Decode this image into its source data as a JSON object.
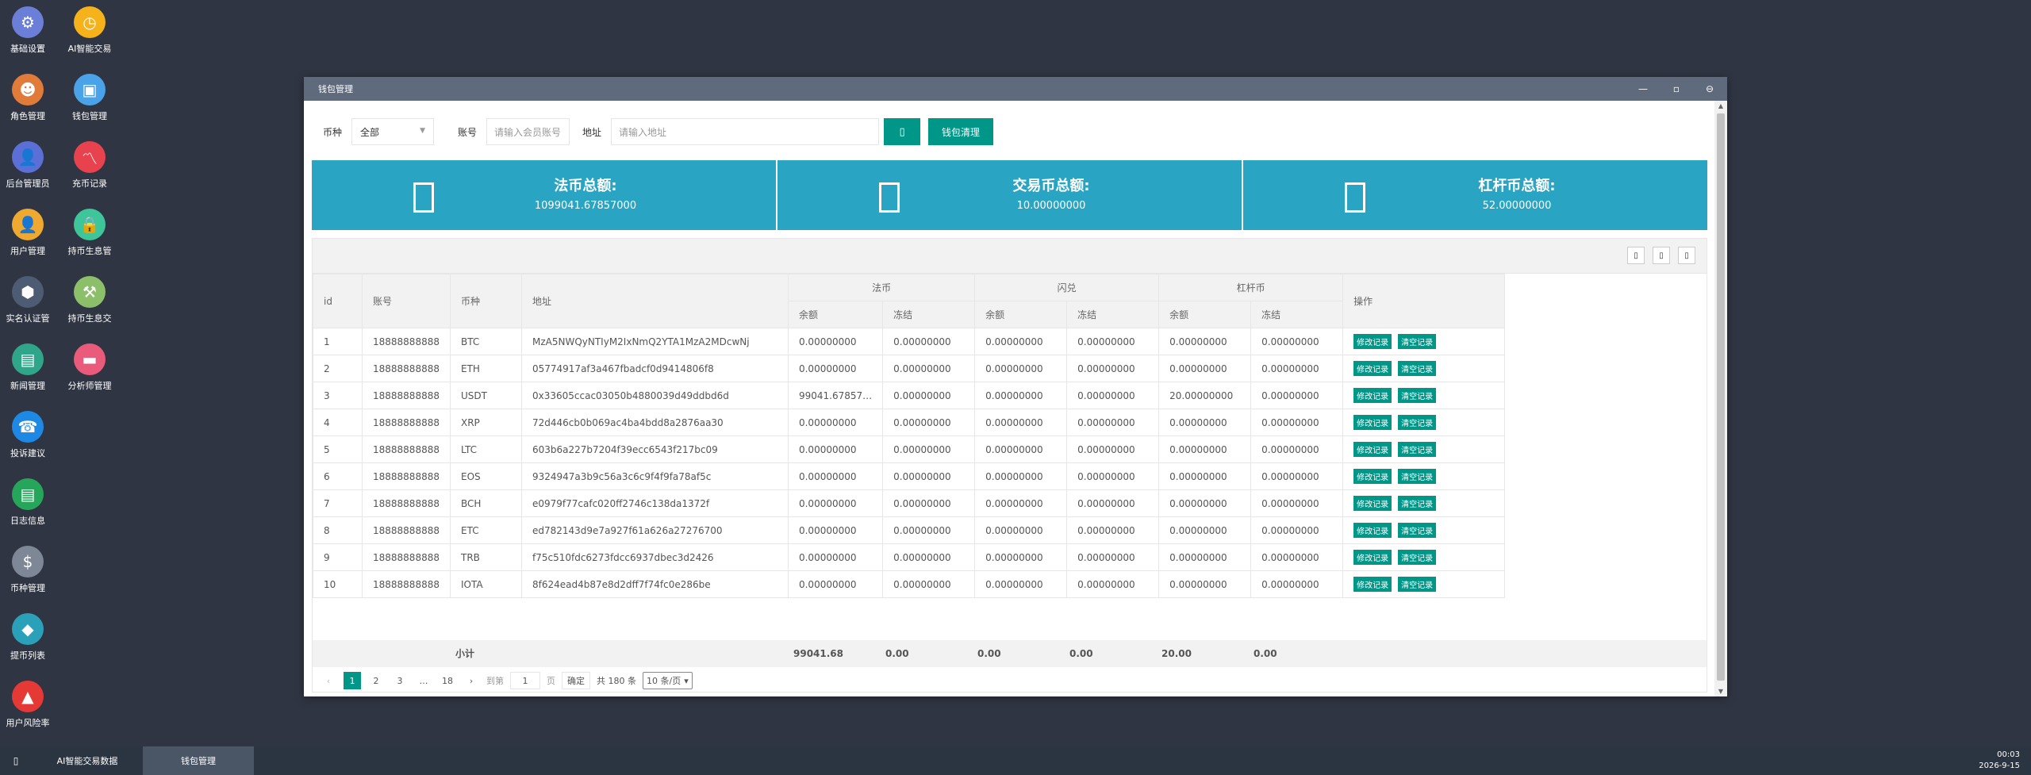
{
  "desktop": {
    "col1": [
      {
        "label": "基础设置",
        "icon": "gear-icon",
        "color": "#6c7fd8",
        "glyph": "⚙"
      },
      {
        "label": "角色管理",
        "icon": "roles-icon",
        "color": "#e07b39",
        "glyph": "☻"
      },
      {
        "label": "后台管理员",
        "icon": "admin-icon",
        "color": "#5b6fd6",
        "glyph": "👤"
      },
      {
        "label": "用户管理",
        "icon": "user-search-icon",
        "color": "#f0a930",
        "glyph": "👤"
      },
      {
        "label": "实名认证管",
        "icon": "verify-icon",
        "color": "#4d5b73",
        "glyph": "⬢"
      },
      {
        "label": "新闻管理",
        "icon": "news-icon",
        "color": "#2fa58a",
        "glyph": "▤"
      },
      {
        "label": "投诉建议",
        "icon": "feedback-icon",
        "color": "#1e88e5",
        "glyph": "☎"
      },
      {
        "label": "日志信息",
        "icon": "log-icon",
        "color": "#26a65b",
        "glyph": "▤"
      },
      {
        "label": "币种管理",
        "icon": "dollar-icon",
        "color": "#7d8796",
        "glyph": "$"
      },
      {
        "label": "提币列表",
        "icon": "withdraw-icon",
        "color": "#2aa1b8",
        "glyph": "◆"
      },
      {
        "label": "用户风险率",
        "icon": "alarm-icon",
        "color": "#e53935",
        "glyph": "▲"
      }
    ],
    "col2": [
      {
        "label": "AI智能交易",
        "icon": "stopwatch-icon",
        "color": "#f5b21a",
        "glyph": "◷"
      },
      {
        "label": "钱包管理",
        "icon": "wallet-icon",
        "color": "#4aa3e8",
        "glyph": "▣"
      },
      {
        "label": "充币记录",
        "icon": "chart-icon",
        "color": "#e8424f",
        "glyph": "〽"
      },
      {
        "label": "持币生息管",
        "icon": "lock-icon",
        "color": "#3ec59a",
        "glyph": "🔒"
      },
      {
        "label": "持币生息交",
        "icon": "hammer-icon",
        "color": "#8bbf6a",
        "glyph": "⚒"
      },
      {
        "label": "分析师管理",
        "icon": "store-icon",
        "color": "#ea5a7a",
        "glyph": "▬"
      }
    ]
  },
  "window": {
    "title": "钱包管理",
    "ctrls": [
      "—",
      "▫",
      "⊖"
    ]
  },
  "filter": {
    "currency_label": "币种",
    "currency_value": "全部",
    "account_label": "账号",
    "account_placeholder": "请输入会员账号",
    "address_label": "地址",
    "address_placeholder": "请输入地址",
    "search_glyph": "▯",
    "clear_label": "钱包清理"
  },
  "stats": [
    {
      "title": "法币总额:",
      "value": "1099041.67857000"
    },
    {
      "title": "交易币总额:",
      "value": "10.00000000"
    },
    {
      "title": "杠杆币总额:",
      "value": "52.00000000"
    }
  ],
  "table": {
    "headers": {
      "id": "id",
      "account": "账号",
      "currency": "币种",
      "address": "地址",
      "fiat": "法币",
      "flash": "闪兑",
      "lever": "杠杆币",
      "balance": "余额",
      "frozen": "冻结",
      "ops": "操作"
    },
    "action_edit": "修改记录",
    "action_clear": "清空记录",
    "rows": [
      [
        "1",
        "18888888888",
        "BTC",
        "MzA5NWQyNTIyM2IxNmQ2YTA1MzA2MDcwNj",
        "0.00000000",
        "0.00000000",
        "0.00000000",
        "0.00000000",
        "0.00000000",
        "0.00000000"
      ],
      [
        "2",
        "18888888888",
        "ETH",
        "05774917af3a467fbadcf0d9414806f8",
        "0.00000000",
        "0.00000000",
        "0.00000000",
        "0.00000000",
        "0.00000000",
        "0.00000000"
      ],
      [
        "3",
        "18888888888",
        "USDT",
        "0x33605ccac03050b4880039d49ddbd6d",
        "99041.67857…",
        "0.00000000",
        "0.00000000",
        "0.00000000",
        "20.00000000",
        "0.00000000"
      ],
      [
        "4",
        "18888888888",
        "XRP",
        "72d446cb0b069ac4ba4bdd8a2876aa30",
        "0.00000000",
        "0.00000000",
        "0.00000000",
        "0.00000000",
        "0.00000000",
        "0.00000000"
      ],
      [
        "5",
        "18888888888",
        "LTC",
        "603b6a227b7204f39ecc6543f217bc09",
        "0.00000000",
        "0.00000000",
        "0.00000000",
        "0.00000000",
        "0.00000000",
        "0.00000000"
      ],
      [
        "6",
        "18888888888",
        "EOS",
        "9324947a3b9c56a3c6c9f4f9fa78af5c",
        "0.00000000",
        "0.00000000",
        "0.00000000",
        "0.00000000",
        "0.00000000",
        "0.00000000"
      ],
      [
        "7",
        "18888888888",
        "BCH",
        "e0979f77cafc020ff2746c138da1372f",
        "0.00000000",
        "0.00000000",
        "0.00000000",
        "0.00000000",
        "0.00000000",
        "0.00000000"
      ],
      [
        "8",
        "18888888888",
        "ETC",
        "ed782143d9e7a927f61a626a27276700",
        "0.00000000",
        "0.00000000",
        "0.00000000",
        "0.00000000",
        "0.00000000",
        "0.00000000"
      ],
      [
        "9",
        "18888888888",
        "TRB",
        "f75c510fdc6273fdcc6937dbec3d2426",
        "0.00000000",
        "0.00000000",
        "0.00000000",
        "0.00000000",
        "0.00000000",
        "0.00000000"
      ],
      [
        "10",
        "18888888888",
        "IOTA",
        "8f624ead4b87e8d2dff7f74fc0e286be",
        "0.00000000",
        "0.00000000",
        "0.00000000",
        "0.00000000",
        "0.00000000",
        "0.00000000"
      ]
    ],
    "summary": {
      "label": "小计",
      "values": [
        "99041.68",
        "0.00",
        "0.00",
        "0.00",
        "20.00",
        "0.00"
      ]
    }
  },
  "pager": {
    "prev": "‹",
    "pages": [
      "1",
      "2",
      "3",
      "…",
      "18"
    ],
    "next": "›",
    "goto_label": "到第",
    "goto_value": "1",
    "page_unit": "页",
    "confirm": "确定",
    "total": "共 180 条",
    "per_page": "10 条/页",
    "per_page_arrow": "▾"
  },
  "taskbar": {
    "start_glyph": "▯",
    "tasks": [
      "AI智能交易数据",
      "钱包管理"
    ],
    "time": "00:03",
    "date": "2026-9-15"
  }
}
